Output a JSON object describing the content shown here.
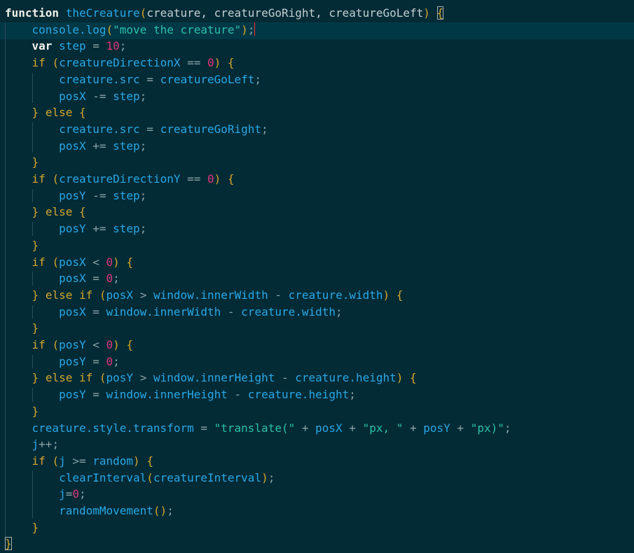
{
  "editor": {
    "colors": {
      "background": "#022b36",
      "current_line": "#003846",
      "keyword": "#f2f2ea",
      "control": "#d4a72c",
      "function": "#2aa7e6",
      "identifier": "#c3cfd2",
      "number": "#e1347a",
      "string": "#2cc0a8",
      "caret": "#ff2d2d"
    },
    "lines": [
      [
        {
          "c": "kw",
          "t": "function"
        },
        {
          "c": "pun",
          "t": " "
        },
        {
          "c": "fn",
          "t": "theCreature"
        },
        {
          "c": "par",
          "t": "("
        },
        {
          "c": "id",
          "t": "creature, creatureGoRight, creatureGoLeft"
        },
        {
          "c": "par",
          "t": ") "
        },
        {
          "c": "par bm",
          "t": "{"
        }
      ],
      [
        {
          "c": "pun",
          "t": "    "
        },
        {
          "c": "fn",
          "t": "console.log"
        },
        {
          "c": "par",
          "t": "("
        },
        {
          "c": "str",
          "t": "\"move the creature\""
        },
        {
          "c": "par",
          "t": ")"
        },
        {
          "c": "pun",
          "t": ";"
        },
        {
          "c": "caret",
          "t": ""
        }
      ],
      [
        {
          "c": "pun",
          "t": "    "
        },
        {
          "c": "kw",
          "t": "var"
        },
        {
          "c": "pun",
          "t": " "
        },
        {
          "c": "obj",
          "t": "step"
        },
        {
          "c": "op",
          "t": " = "
        },
        {
          "c": "num",
          "t": "10"
        },
        {
          "c": "pun",
          "t": ";"
        }
      ],
      [
        {
          "c": "pun",
          "t": "    "
        },
        {
          "c": "ctl",
          "t": "if"
        },
        {
          "c": "pun",
          "t": " "
        },
        {
          "c": "par",
          "t": "("
        },
        {
          "c": "obj",
          "t": "creatureDirectionX"
        },
        {
          "c": "op",
          "t": " == "
        },
        {
          "c": "num",
          "t": "0"
        },
        {
          "c": "par",
          "t": ")"
        },
        {
          "c": "pun",
          "t": " "
        },
        {
          "c": "par",
          "t": "{"
        }
      ],
      [
        {
          "c": "pun",
          "t": "        "
        },
        {
          "c": "obj",
          "t": "creature.src"
        },
        {
          "c": "op",
          "t": " = "
        },
        {
          "c": "obj",
          "t": "creatureGoLeft"
        },
        {
          "c": "pun",
          "t": ";"
        }
      ],
      [
        {
          "c": "pun",
          "t": "        "
        },
        {
          "c": "obj",
          "t": "posX"
        },
        {
          "c": "op",
          "t": " -= "
        },
        {
          "c": "obj",
          "t": "step"
        },
        {
          "c": "pun",
          "t": ";"
        }
      ],
      [
        {
          "c": "pun",
          "t": "    "
        },
        {
          "c": "par",
          "t": "}"
        },
        {
          "c": "pun",
          "t": " "
        },
        {
          "c": "ctl",
          "t": "else"
        },
        {
          "c": "pun",
          "t": " "
        },
        {
          "c": "par",
          "t": "{"
        }
      ],
      [
        {
          "c": "pun",
          "t": "        "
        },
        {
          "c": "obj",
          "t": "creature.src"
        },
        {
          "c": "op",
          "t": " = "
        },
        {
          "c": "obj",
          "t": "creatureGoRight"
        },
        {
          "c": "pun",
          "t": ";"
        }
      ],
      [
        {
          "c": "pun",
          "t": "        "
        },
        {
          "c": "obj",
          "t": "posX"
        },
        {
          "c": "op",
          "t": " += "
        },
        {
          "c": "obj",
          "t": "step"
        },
        {
          "c": "pun",
          "t": ";"
        }
      ],
      [
        {
          "c": "pun",
          "t": "    "
        },
        {
          "c": "par",
          "t": "}"
        }
      ],
      [
        {
          "c": "pun",
          "t": "    "
        },
        {
          "c": "ctl",
          "t": "if"
        },
        {
          "c": "pun",
          "t": " "
        },
        {
          "c": "par",
          "t": "("
        },
        {
          "c": "obj",
          "t": "creatureDirectionY"
        },
        {
          "c": "op",
          "t": " == "
        },
        {
          "c": "num",
          "t": "0"
        },
        {
          "c": "par",
          "t": ")"
        },
        {
          "c": "pun",
          "t": " "
        },
        {
          "c": "par",
          "t": "{"
        }
      ],
      [
        {
          "c": "pun",
          "t": "        "
        },
        {
          "c": "obj",
          "t": "posY"
        },
        {
          "c": "op",
          "t": " -= "
        },
        {
          "c": "obj",
          "t": "step"
        },
        {
          "c": "pun",
          "t": ";"
        }
      ],
      [
        {
          "c": "pun",
          "t": "    "
        },
        {
          "c": "par",
          "t": "}"
        },
        {
          "c": "pun",
          "t": " "
        },
        {
          "c": "ctl",
          "t": "else"
        },
        {
          "c": "pun",
          "t": " "
        },
        {
          "c": "par",
          "t": "{"
        }
      ],
      [
        {
          "c": "pun",
          "t": "        "
        },
        {
          "c": "obj",
          "t": "posY"
        },
        {
          "c": "op",
          "t": " += "
        },
        {
          "c": "obj",
          "t": "step"
        },
        {
          "c": "pun",
          "t": ";"
        }
      ],
      [
        {
          "c": "pun",
          "t": "    "
        },
        {
          "c": "par",
          "t": "}"
        }
      ],
      [
        {
          "c": "pun",
          "t": "    "
        },
        {
          "c": "ctl",
          "t": "if"
        },
        {
          "c": "pun",
          "t": " "
        },
        {
          "c": "par",
          "t": "("
        },
        {
          "c": "obj",
          "t": "posX"
        },
        {
          "c": "op",
          "t": " < "
        },
        {
          "c": "num",
          "t": "0"
        },
        {
          "c": "par",
          "t": ")"
        },
        {
          "c": "pun",
          "t": " "
        },
        {
          "c": "par",
          "t": "{"
        }
      ],
      [
        {
          "c": "pun",
          "t": "        "
        },
        {
          "c": "obj",
          "t": "posX"
        },
        {
          "c": "op",
          "t": " = "
        },
        {
          "c": "num",
          "t": "0"
        },
        {
          "c": "pun",
          "t": ";"
        }
      ],
      [
        {
          "c": "pun",
          "t": "    "
        },
        {
          "c": "par",
          "t": "}"
        },
        {
          "c": "pun",
          "t": " "
        },
        {
          "c": "ctl",
          "t": "else if"
        },
        {
          "c": "pun",
          "t": " "
        },
        {
          "c": "par",
          "t": "("
        },
        {
          "c": "obj",
          "t": "posX"
        },
        {
          "c": "op",
          "t": " > "
        },
        {
          "c": "obj",
          "t": "window.innerWidth"
        },
        {
          "c": "op",
          "t": " - "
        },
        {
          "c": "obj",
          "t": "creature.width"
        },
        {
          "c": "par",
          "t": ")"
        },
        {
          "c": "pun",
          "t": " "
        },
        {
          "c": "par",
          "t": "{"
        }
      ],
      [
        {
          "c": "pun",
          "t": "        "
        },
        {
          "c": "obj",
          "t": "posX"
        },
        {
          "c": "op",
          "t": " = "
        },
        {
          "c": "obj",
          "t": "window.innerWidth"
        },
        {
          "c": "op",
          "t": " - "
        },
        {
          "c": "obj",
          "t": "creature.width"
        },
        {
          "c": "pun",
          "t": ";"
        }
      ],
      [
        {
          "c": "pun",
          "t": "    "
        },
        {
          "c": "par",
          "t": "}"
        }
      ],
      [
        {
          "c": "pun",
          "t": "    "
        },
        {
          "c": "ctl",
          "t": "if"
        },
        {
          "c": "pun",
          "t": " "
        },
        {
          "c": "par",
          "t": "("
        },
        {
          "c": "obj",
          "t": "posY"
        },
        {
          "c": "op",
          "t": " < "
        },
        {
          "c": "num",
          "t": "0"
        },
        {
          "c": "par",
          "t": ")"
        },
        {
          "c": "pun",
          "t": " "
        },
        {
          "c": "par",
          "t": "{"
        }
      ],
      [
        {
          "c": "pun",
          "t": "        "
        },
        {
          "c": "obj",
          "t": "posY"
        },
        {
          "c": "op",
          "t": " = "
        },
        {
          "c": "num",
          "t": "0"
        },
        {
          "c": "pun",
          "t": ";"
        }
      ],
      [
        {
          "c": "pun",
          "t": "    "
        },
        {
          "c": "par",
          "t": "}"
        },
        {
          "c": "pun",
          "t": " "
        },
        {
          "c": "ctl",
          "t": "else if"
        },
        {
          "c": "pun",
          "t": " "
        },
        {
          "c": "par",
          "t": "("
        },
        {
          "c": "obj",
          "t": "posY"
        },
        {
          "c": "op",
          "t": " > "
        },
        {
          "c": "obj",
          "t": "window.innerHeight"
        },
        {
          "c": "op",
          "t": " - "
        },
        {
          "c": "obj",
          "t": "creature.height"
        },
        {
          "c": "par",
          "t": ")"
        },
        {
          "c": "pun",
          "t": " "
        },
        {
          "c": "par",
          "t": "{"
        }
      ],
      [
        {
          "c": "pun",
          "t": "        "
        },
        {
          "c": "obj",
          "t": "posY"
        },
        {
          "c": "op",
          "t": " = "
        },
        {
          "c": "obj",
          "t": "window.innerHeight"
        },
        {
          "c": "op",
          "t": " - "
        },
        {
          "c": "obj",
          "t": "creature.height"
        },
        {
          "c": "pun",
          "t": ";"
        }
      ],
      [
        {
          "c": "pun",
          "t": "    "
        },
        {
          "c": "par",
          "t": "}"
        }
      ],
      [
        {
          "c": "pun",
          "t": "    "
        },
        {
          "c": "obj",
          "t": "creature.style.transform"
        },
        {
          "c": "op",
          "t": " = "
        },
        {
          "c": "str",
          "t": "\"translate(\""
        },
        {
          "c": "op",
          "t": " + "
        },
        {
          "c": "obj",
          "t": "posX"
        },
        {
          "c": "op",
          "t": " + "
        },
        {
          "c": "str",
          "t": "\"px, \""
        },
        {
          "c": "op",
          "t": " + "
        },
        {
          "c": "obj",
          "t": "posY"
        },
        {
          "c": "op",
          "t": " + "
        },
        {
          "c": "str",
          "t": "\"px)\""
        },
        {
          "c": "pun",
          "t": ";"
        }
      ],
      [
        {
          "c": "pun",
          "t": "    "
        },
        {
          "c": "obj",
          "t": "j"
        },
        {
          "c": "op",
          "t": "++"
        },
        {
          "c": "pun",
          "t": ";"
        }
      ],
      [
        {
          "c": "pun",
          "t": "    "
        },
        {
          "c": "ctl",
          "t": "if"
        },
        {
          "c": "pun",
          "t": " "
        },
        {
          "c": "par",
          "t": "("
        },
        {
          "c": "obj",
          "t": "j"
        },
        {
          "c": "op",
          "t": " >= "
        },
        {
          "c": "obj",
          "t": "random"
        },
        {
          "c": "par",
          "t": ")"
        },
        {
          "c": "pun",
          "t": " "
        },
        {
          "c": "par",
          "t": "{"
        }
      ],
      [
        {
          "c": "pun",
          "t": "        "
        },
        {
          "c": "fn",
          "t": "clearInterval"
        },
        {
          "c": "par",
          "t": "("
        },
        {
          "c": "obj",
          "t": "creatureInterval"
        },
        {
          "c": "par",
          "t": ")"
        },
        {
          "c": "pun",
          "t": ";"
        }
      ],
      [
        {
          "c": "pun",
          "t": "        "
        },
        {
          "c": "obj",
          "t": "j"
        },
        {
          "c": "op",
          "t": "="
        },
        {
          "c": "num",
          "t": "0"
        },
        {
          "c": "pun",
          "t": ";"
        }
      ],
      [
        {
          "c": "pun",
          "t": "        "
        },
        {
          "c": "fn",
          "t": "randomMovement"
        },
        {
          "c": "par",
          "t": "()"
        },
        {
          "c": "pun",
          "t": ";"
        }
      ],
      [
        {
          "c": "pun",
          "t": "    "
        },
        {
          "c": "par",
          "t": "}"
        }
      ],
      [
        {
          "c": "par bm",
          "t": "}"
        }
      ]
    ]
  }
}
